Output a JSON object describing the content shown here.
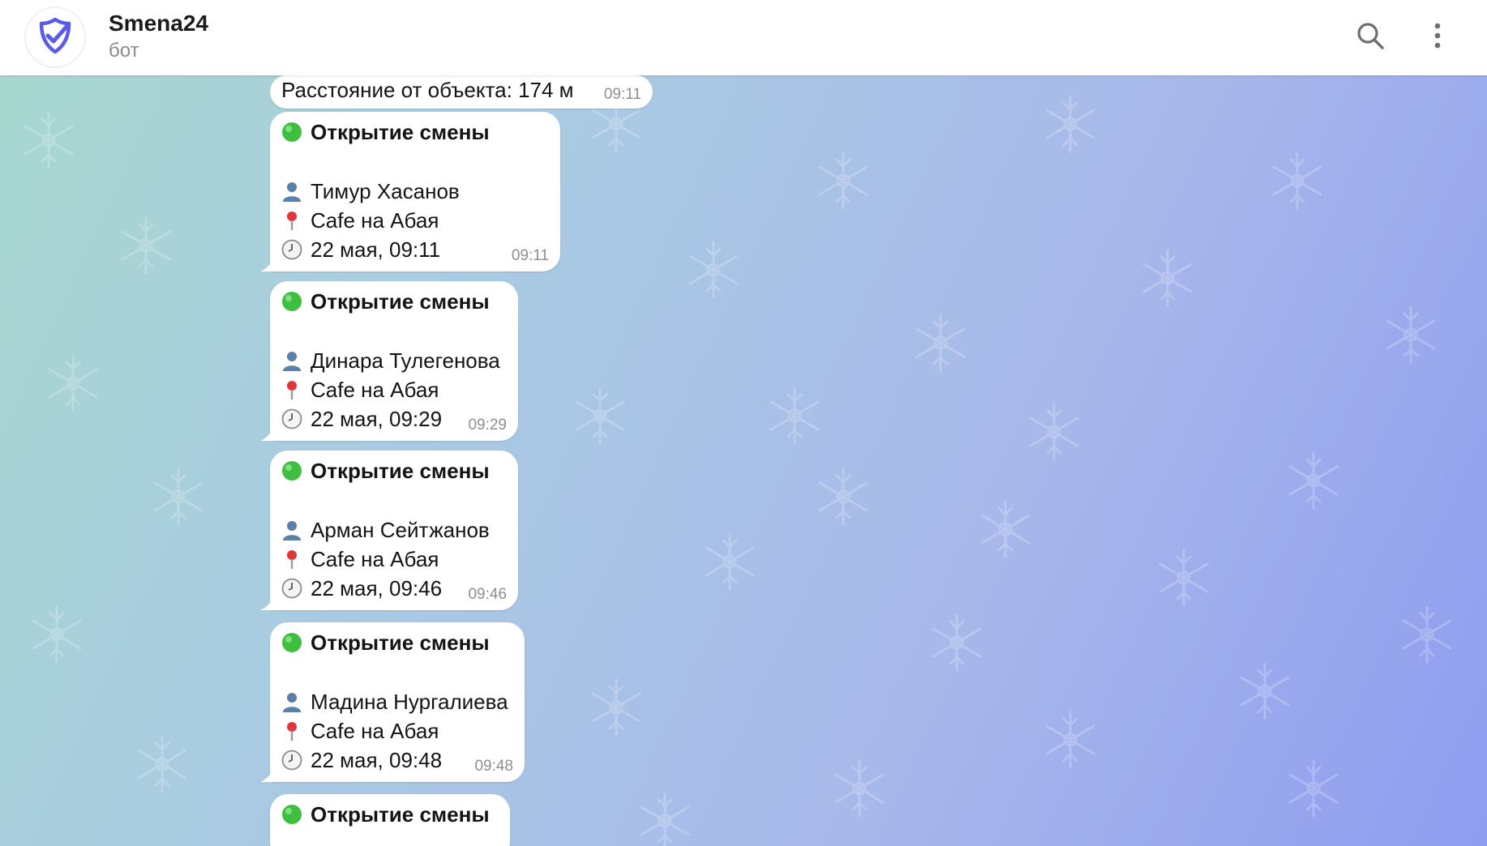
{
  "header": {
    "title": "Smena24",
    "subtitle": "бот",
    "avatar_icon": "check-shield-icon",
    "search_icon": "search-icon",
    "menu_icon": "more-vertical-icon"
  },
  "colors": {
    "accent": "#5b5bea",
    "bubble": "#ffffff",
    "time": "#8e8e8e",
    "green_dot": "#3fbf3f"
  },
  "messages": [
    {
      "text": "Расстояние от объекта: 174 м",
      "time": "09:11"
    },
    {
      "heading": "Открытие смены",
      "person": "Тимур Хасанов",
      "place": "Cafe на Абая",
      "datetime": "22 мая, 09:11",
      "time": "09:11"
    },
    {
      "heading": "Открытие смены",
      "person": "Динара Тулегенова",
      "place": "Cafe на Абая",
      "datetime": "22 мая, 09:29",
      "time": "09:29"
    },
    {
      "heading": "Открытие смены",
      "person": "Арман Сейтжанов",
      "place": "Cafe на Абая",
      "datetime": "22 мая, 09:46",
      "time": "09:46"
    },
    {
      "heading": "Открытие смены",
      "person": "Мадина Нургалиева",
      "place": "Cafe на Абая",
      "datetime": "22 мая, 09:48",
      "time": "09:48"
    },
    {
      "heading": "Открытие смены"
    }
  ]
}
